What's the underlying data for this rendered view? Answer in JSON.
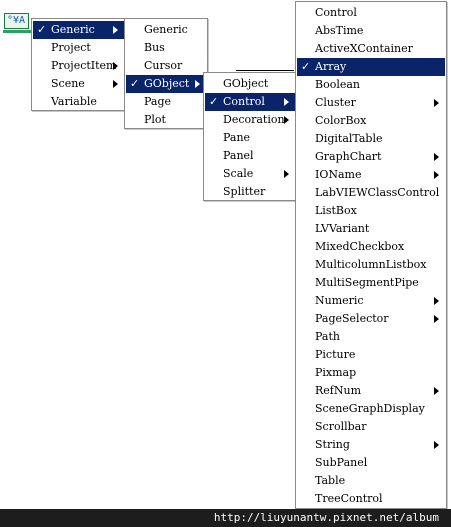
{
  "menus": {
    "level1": {
      "items": [
        {
          "label": "Generic",
          "checked": true,
          "submenu": true,
          "selected": true
        },
        {
          "label": "Project",
          "checked": false,
          "submenu": false,
          "selected": false
        },
        {
          "label": "ProjectItem",
          "checked": false,
          "submenu": true,
          "selected": false
        },
        {
          "label": "Scene",
          "checked": false,
          "submenu": true,
          "selected": false
        },
        {
          "label": "Variable",
          "checked": false,
          "submenu": false,
          "selected": false
        }
      ]
    },
    "level2": {
      "items": [
        {
          "label": "Generic",
          "checked": false,
          "submenu": false,
          "selected": false
        },
        {
          "label": "Bus",
          "checked": false,
          "submenu": false,
          "selected": false
        },
        {
          "label": "Cursor",
          "checked": false,
          "submenu": false,
          "selected": false
        },
        {
          "label": "GObject",
          "checked": true,
          "submenu": true,
          "selected": true
        },
        {
          "label": "Page",
          "checked": false,
          "submenu": false,
          "selected": false
        },
        {
          "label": "Plot",
          "checked": false,
          "submenu": false,
          "selected": false
        }
      ]
    },
    "level3": {
      "items": [
        {
          "label": "GObject",
          "checked": false,
          "submenu": false,
          "selected": false
        },
        {
          "label": "Control",
          "checked": true,
          "submenu": true,
          "selected": true
        },
        {
          "label": "Decoration",
          "checked": false,
          "submenu": true,
          "selected": false
        },
        {
          "label": "Pane",
          "checked": false,
          "submenu": false,
          "selected": false
        },
        {
          "label": "Panel",
          "checked": false,
          "submenu": false,
          "selected": false
        },
        {
          "label": "Scale",
          "checked": false,
          "submenu": true,
          "selected": false
        },
        {
          "label": "Splitter",
          "checked": false,
          "submenu": false,
          "selected": false
        }
      ]
    },
    "level4": {
      "items": [
        {
          "label": "Control",
          "checked": false,
          "submenu": false,
          "selected": false
        },
        {
          "label": "AbsTime",
          "checked": false,
          "submenu": false,
          "selected": false
        },
        {
          "label": "ActiveXContainer",
          "checked": false,
          "submenu": false,
          "selected": false
        },
        {
          "label": "Array",
          "checked": true,
          "submenu": false,
          "selected": true
        },
        {
          "label": "Boolean",
          "checked": false,
          "submenu": false,
          "selected": false
        },
        {
          "label": "Cluster",
          "checked": false,
          "submenu": true,
          "selected": false
        },
        {
          "label": "ColorBox",
          "checked": false,
          "submenu": false,
          "selected": false
        },
        {
          "label": "DigitalTable",
          "checked": false,
          "submenu": false,
          "selected": false
        },
        {
          "label": "GraphChart",
          "checked": false,
          "submenu": true,
          "selected": false
        },
        {
          "label": "IOName",
          "checked": false,
          "submenu": true,
          "selected": false
        },
        {
          "label": "LabVIEWClassControl",
          "checked": false,
          "submenu": false,
          "selected": false
        },
        {
          "label": "ListBox",
          "checked": false,
          "submenu": false,
          "selected": false
        },
        {
          "label": "LVVariant",
          "checked": false,
          "submenu": false,
          "selected": false
        },
        {
          "label": "MixedCheckbox",
          "checked": false,
          "submenu": false,
          "selected": false
        },
        {
          "label": "MulticolumnListbox",
          "checked": false,
          "submenu": false,
          "selected": false
        },
        {
          "label": "MultiSegmentPipe",
          "checked": false,
          "submenu": false,
          "selected": false
        },
        {
          "label": "Numeric",
          "checked": false,
          "submenu": true,
          "selected": false
        },
        {
          "label": "PageSelector",
          "checked": false,
          "submenu": true,
          "selected": false
        },
        {
          "label": "Path",
          "checked": false,
          "submenu": false,
          "selected": false
        },
        {
          "label": "Picture",
          "checked": false,
          "submenu": false,
          "selected": false
        },
        {
          "label": "Pixmap",
          "checked": false,
          "submenu": false,
          "selected": false
        },
        {
          "label": "RefNum",
          "checked": false,
          "submenu": true,
          "selected": false
        },
        {
          "label": "SceneGraphDisplay",
          "checked": false,
          "submenu": false,
          "selected": false
        },
        {
          "label": "Scrollbar",
          "checked": false,
          "submenu": false,
          "selected": false
        },
        {
          "label": "String",
          "checked": false,
          "submenu": true,
          "selected": false
        },
        {
          "label": "SubPanel",
          "checked": false,
          "submenu": false,
          "selected": false
        },
        {
          "label": "Table",
          "checked": false,
          "submenu": false,
          "selected": false
        },
        {
          "label": "TreeControl",
          "checked": false,
          "submenu": false,
          "selected": false
        }
      ]
    }
  },
  "node_icon": {
    "text": "°¥A",
    "icon": "class-specifier-constant-icon"
  },
  "check_glyph": "✓",
  "footer": {
    "url": "http://liuyunantw.pixnet.net/album"
  },
  "colors": {
    "selection": "#0a246a",
    "wire": "#2f9f63",
    "footer_bg": "#1d1d1d"
  }
}
